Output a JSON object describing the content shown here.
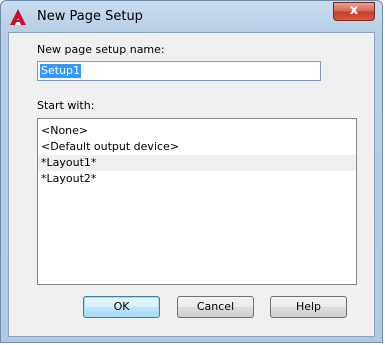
{
  "window": {
    "title": "New Page Setup",
    "close_label": "x"
  },
  "form": {
    "name_label": "New page setup name:",
    "name_value": "Setup1",
    "start_label": "Start with:"
  },
  "list": {
    "items": [
      "<None>",
      "<Default output device>",
      "*Layout1*",
      "*Layout2*"
    ],
    "selected_index": 2
  },
  "buttons": {
    "ok": "OK",
    "cancel": "Cancel",
    "help": "Help"
  },
  "colors": {
    "app_icon": "#c8102e",
    "selection": "#3399ff"
  },
  "icons": {
    "app": "autocad-a-icon",
    "close": "close-icon"
  }
}
